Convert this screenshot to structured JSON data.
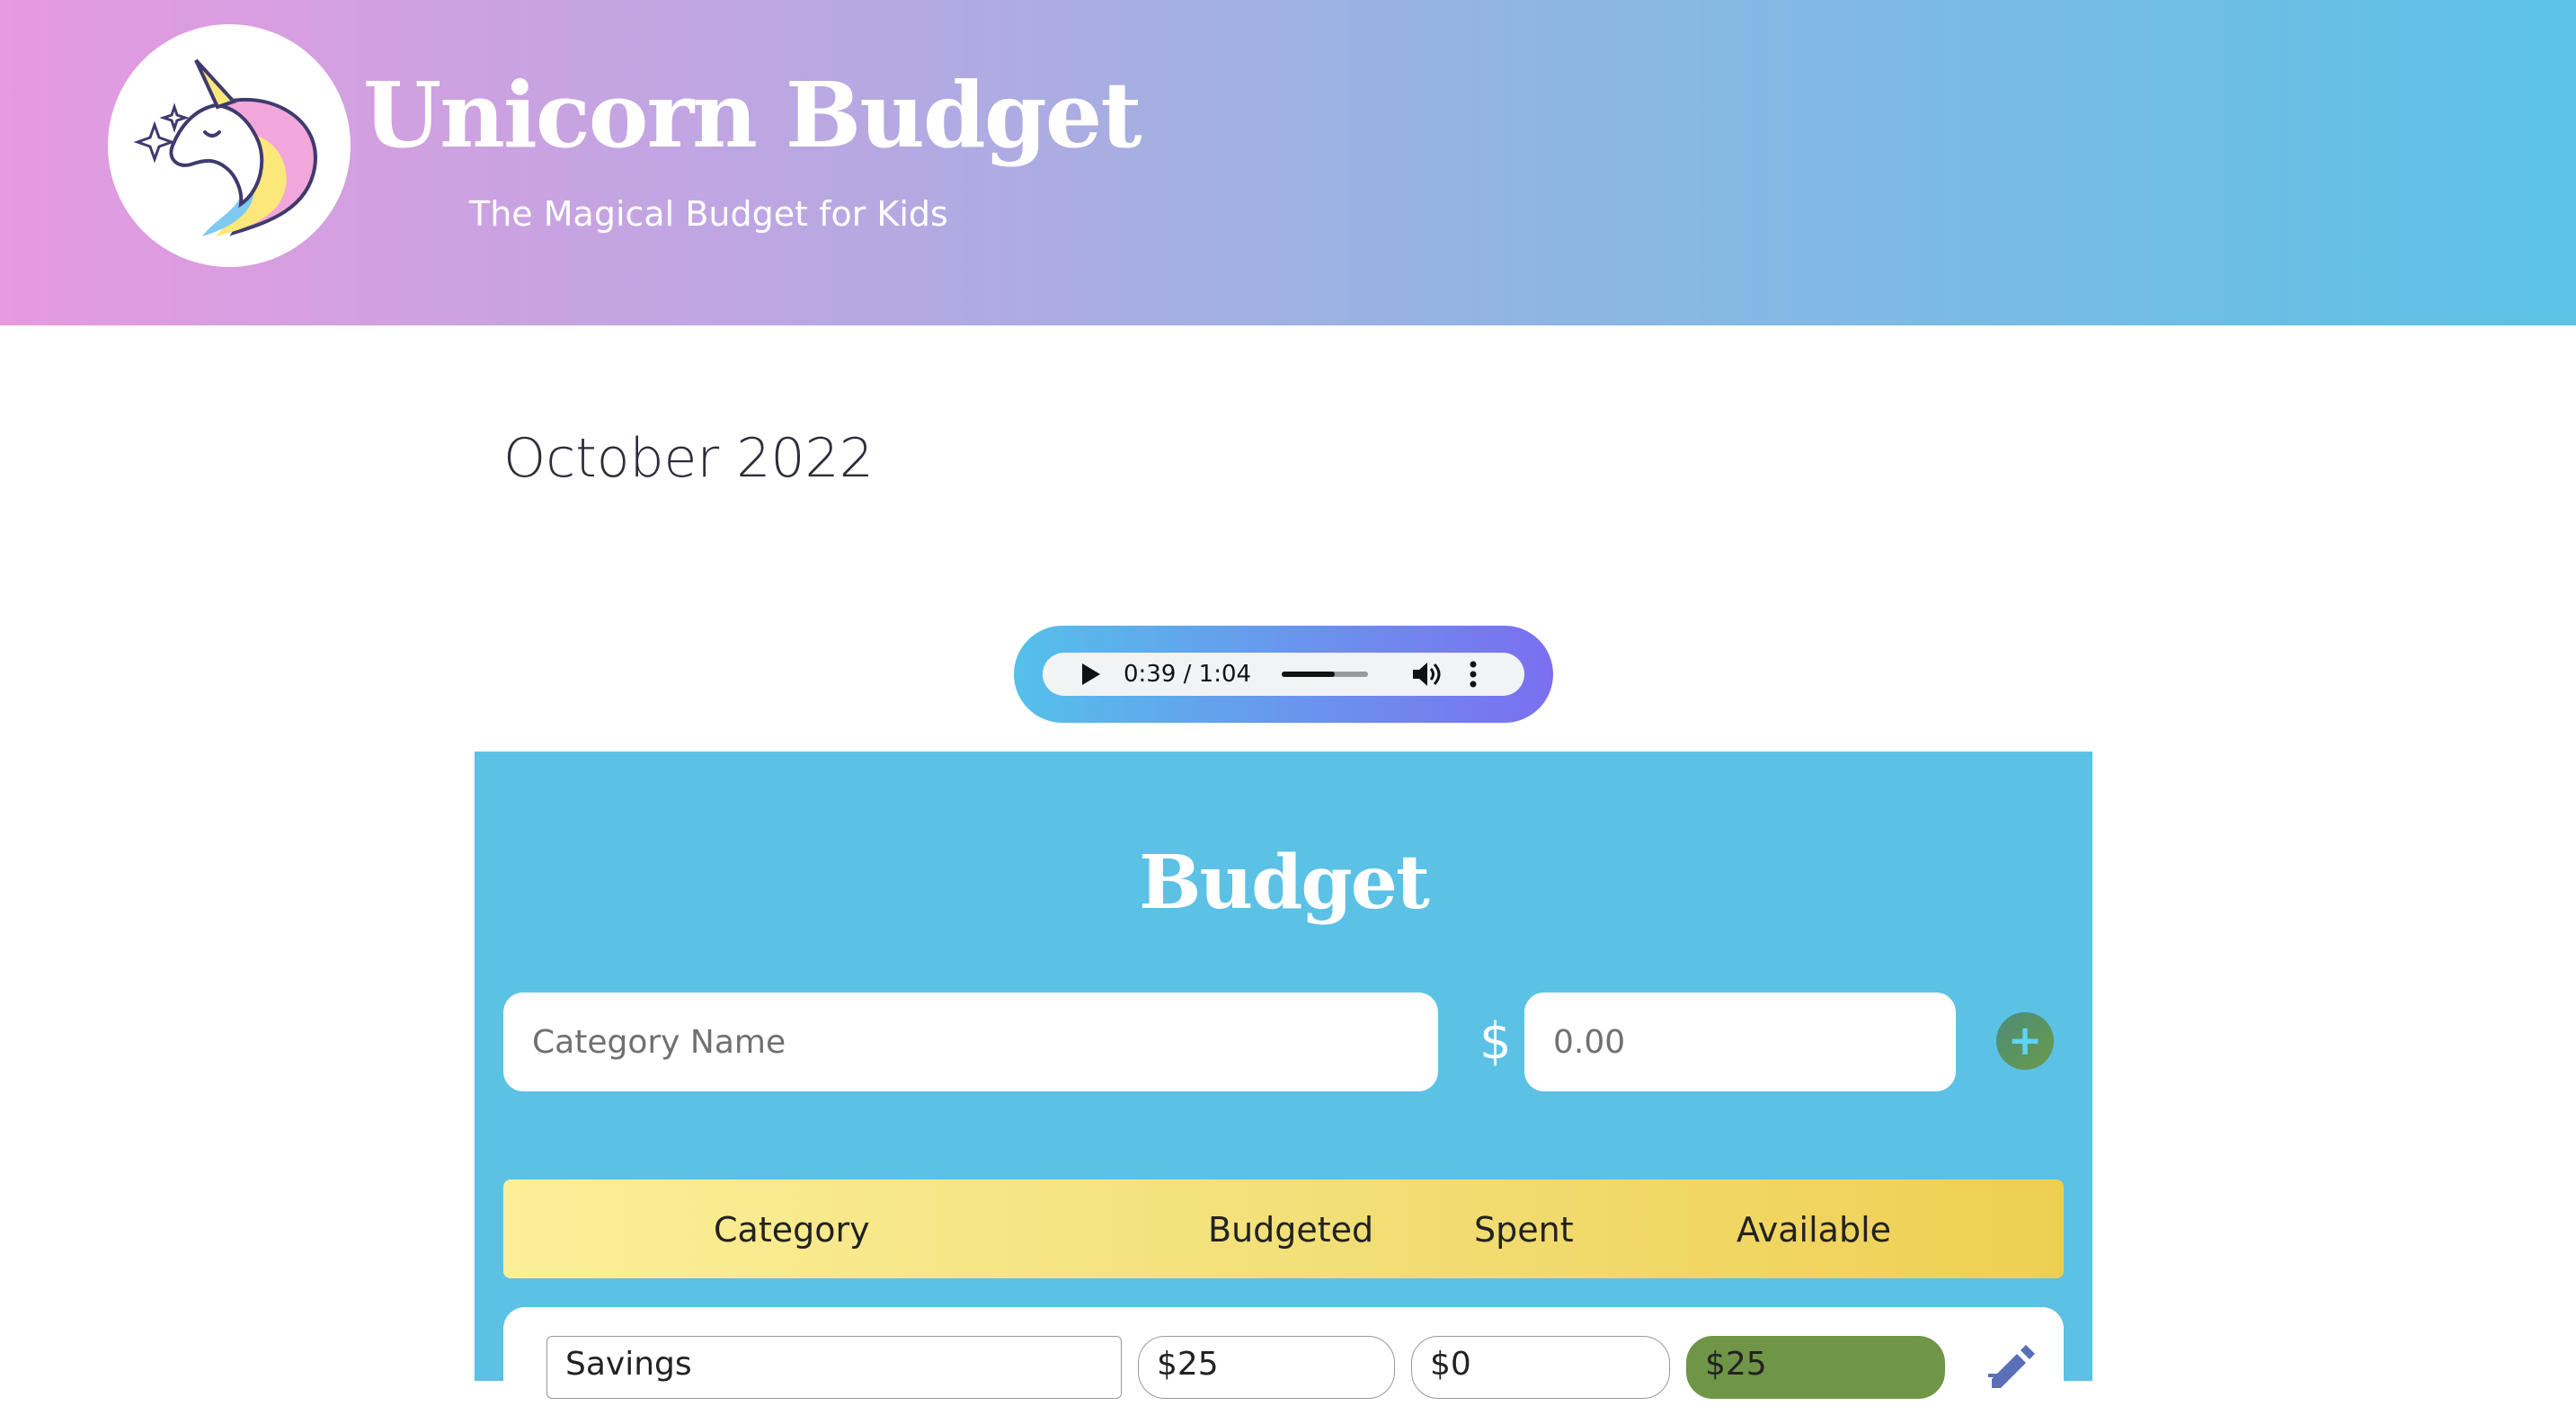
{
  "header": {
    "title": "Unicorn Budget",
    "subtitle": "The Magical Budget for Kids",
    "logo_icon": "unicorn-icon"
  },
  "month": "October 2022",
  "audio": {
    "time": "0:39 / 1:04",
    "progress": 0.61,
    "play_icon": "play-icon",
    "volume_icon": "volume-icon",
    "menu_icon": "more-vertical-icon"
  },
  "budget": {
    "title": "Budget",
    "category_placeholder": "Category Name",
    "currency": "$",
    "amount_placeholder": "0.00",
    "add_label": "+",
    "columns": [
      "Category",
      "Budgeted",
      "Spent",
      "Available"
    ],
    "rows": [
      {
        "category": "Savings",
        "budgeted": "$25",
        "spent": "$0",
        "available": "$25"
      }
    ]
  },
  "colors": {
    "header_gradient_start": "#e69ae0",
    "header_gradient_end": "#5cc2e6",
    "panel": "#5bc1e5",
    "table_header": "#f3e07a",
    "available_badge": "#6e9646"
  }
}
